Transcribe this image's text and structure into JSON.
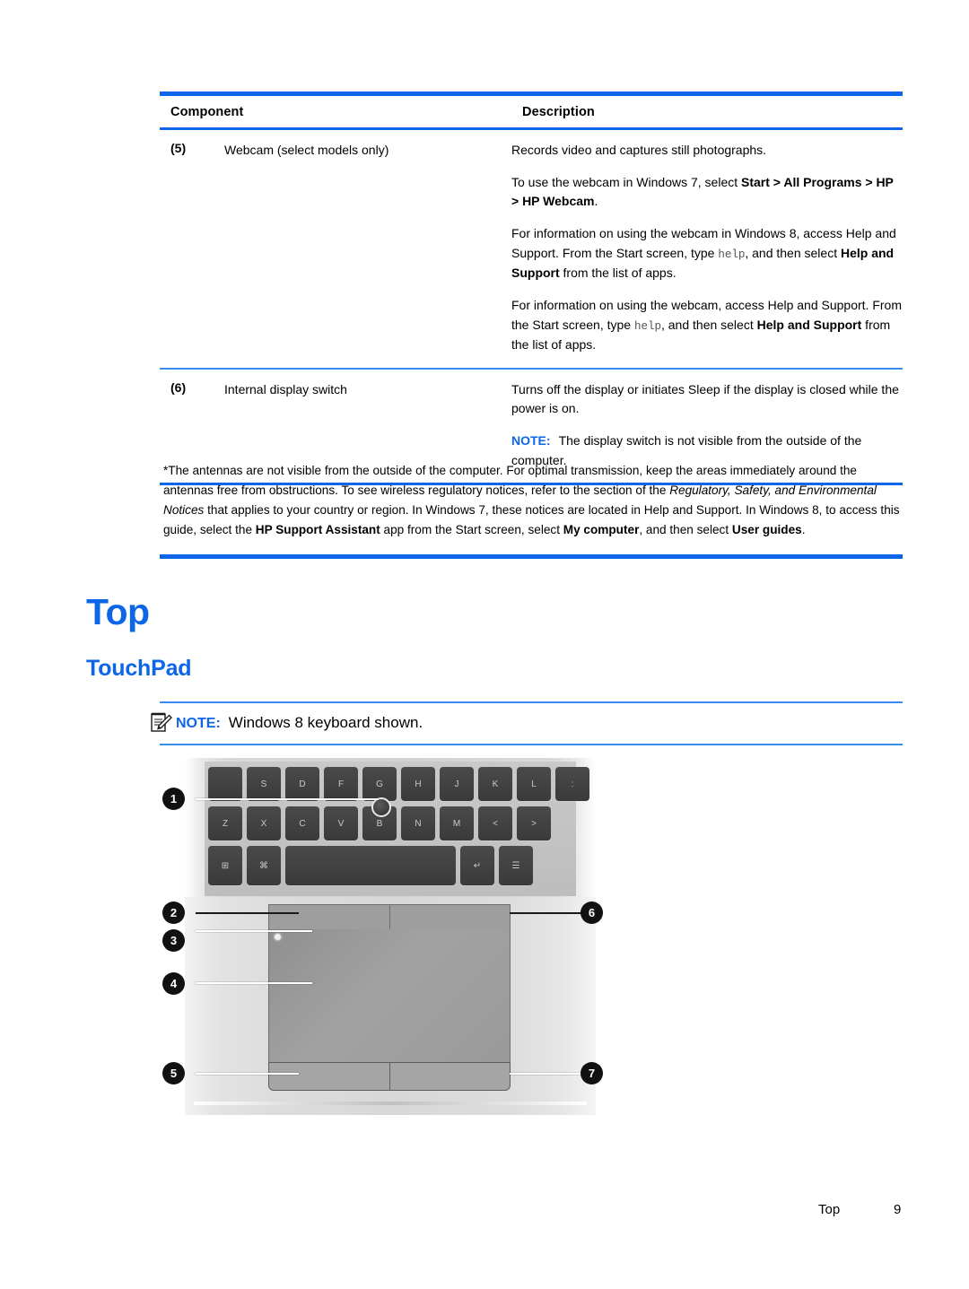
{
  "table": {
    "headers": {
      "component": "Component",
      "description": "Description"
    },
    "rows": [
      {
        "num": "(5)",
        "name": "Webcam (select models only)",
        "desc_p1": "Records video and captures still photographs.",
        "desc_p2_pre": "To use the webcam in Windows 7, select ",
        "desc_p2_bold": "Start > All Programs > HP > HP Webcam",
        "desc_p2_post": ".",
        "desc_p3_pre": "For information on using the webcam in Windows 8, access Help and Support. From the Start screen, type ",
        "desc_p3_mono": "help",
        "desc_p3_mid": ", and then select ",
        "desc_p3_bold": "Help and Support",
        "desc_p3_post": " from the list of apps.",
        "desc_p4_pre": "For information on using the webcam, access Help and Support. From the Start screen, type ",
        "desc_p4_mono": "help",
        "desc_p4_mid": ", and then select ",
        "desc_p4_bold": "Help and Support",
        "desc_p4_post": " from the list of apps."
      },
      {
        "num": "(6)",
        "name": "Internal display switch",
        "desc_p1": "Turns off the display or initiates Sleep if the display is closed while the power is on.",
        "note_label": "NOTE:",
        "note_text": "The display switch is not visible from the outside of the computer."
      }
    ]
  },
  "footnote": {
    "seg1": "*The antennas are not visible from the outside of the computer. For optimal transmission, keep the areas immediately around the antennas free from obstructions. To see wireless regulatory notices, refer to the section of the ",
    "italic1": "Regulatory, Safety, and Environmental Notices",
    "seg2": " that applies to your country or region. In Windows 7, these notices are located in Help and Support. In Windows 8, to access this guide, select the ",
    "bold1": "HP Support Assistant",
    "seg3": " app from the Start screen, select ",
    "bold2": "My computer",
    "seg4": ", and then select ",
    "bold3": "User guides",
    "seg5": "."
  },
  "headings": {
    "h1": "Top",
    "h2": "TouchPad"
  },
  "note_box": {
    "label": "NOTE:",
    "text": "Windows 8 keyboard shown.",
    "icon": "note-pencil-icon"
  },
  "illustration": {
    "keyboard_row_1": [
      "",
      "S",
      "D",
      "F",
      "G",
      "H",
      "J",
      "K",
      "L",
      ":"
    ],
    "keyboard_row_2": [
      "Z",
      "X",
      "C",
      "V",
      "B",
      "N",
      "M",
      "<",
      ">"
    ],
    "keyboard_row_3": [
      "⊞",
      "⌘",
      "",
      "↵",
      "☰"
    ],
    "callouts": [
      {
        "id": "1",
        "label": "1"
      },
      {
        "id": "2",
        "label": "2"
      },
      {
        "id": "3",
        "label": "3"
      },
      {
        "id": "4",
        "label": "4"
      },
      {
        "id": "5",
        "label": "5"
      },
      {
        "id": "6",
        "label": "6"
      },
      {
        "id": "7",
        "label": "7"
      }
    ]
  },
  "footer": {
    "section": "Top",
    "page_number": "9"
  },
  "colors": {
    "accent_blue": "#0d66e8",
    "rule_light_blue": "#3b8cf0"
  }
}
